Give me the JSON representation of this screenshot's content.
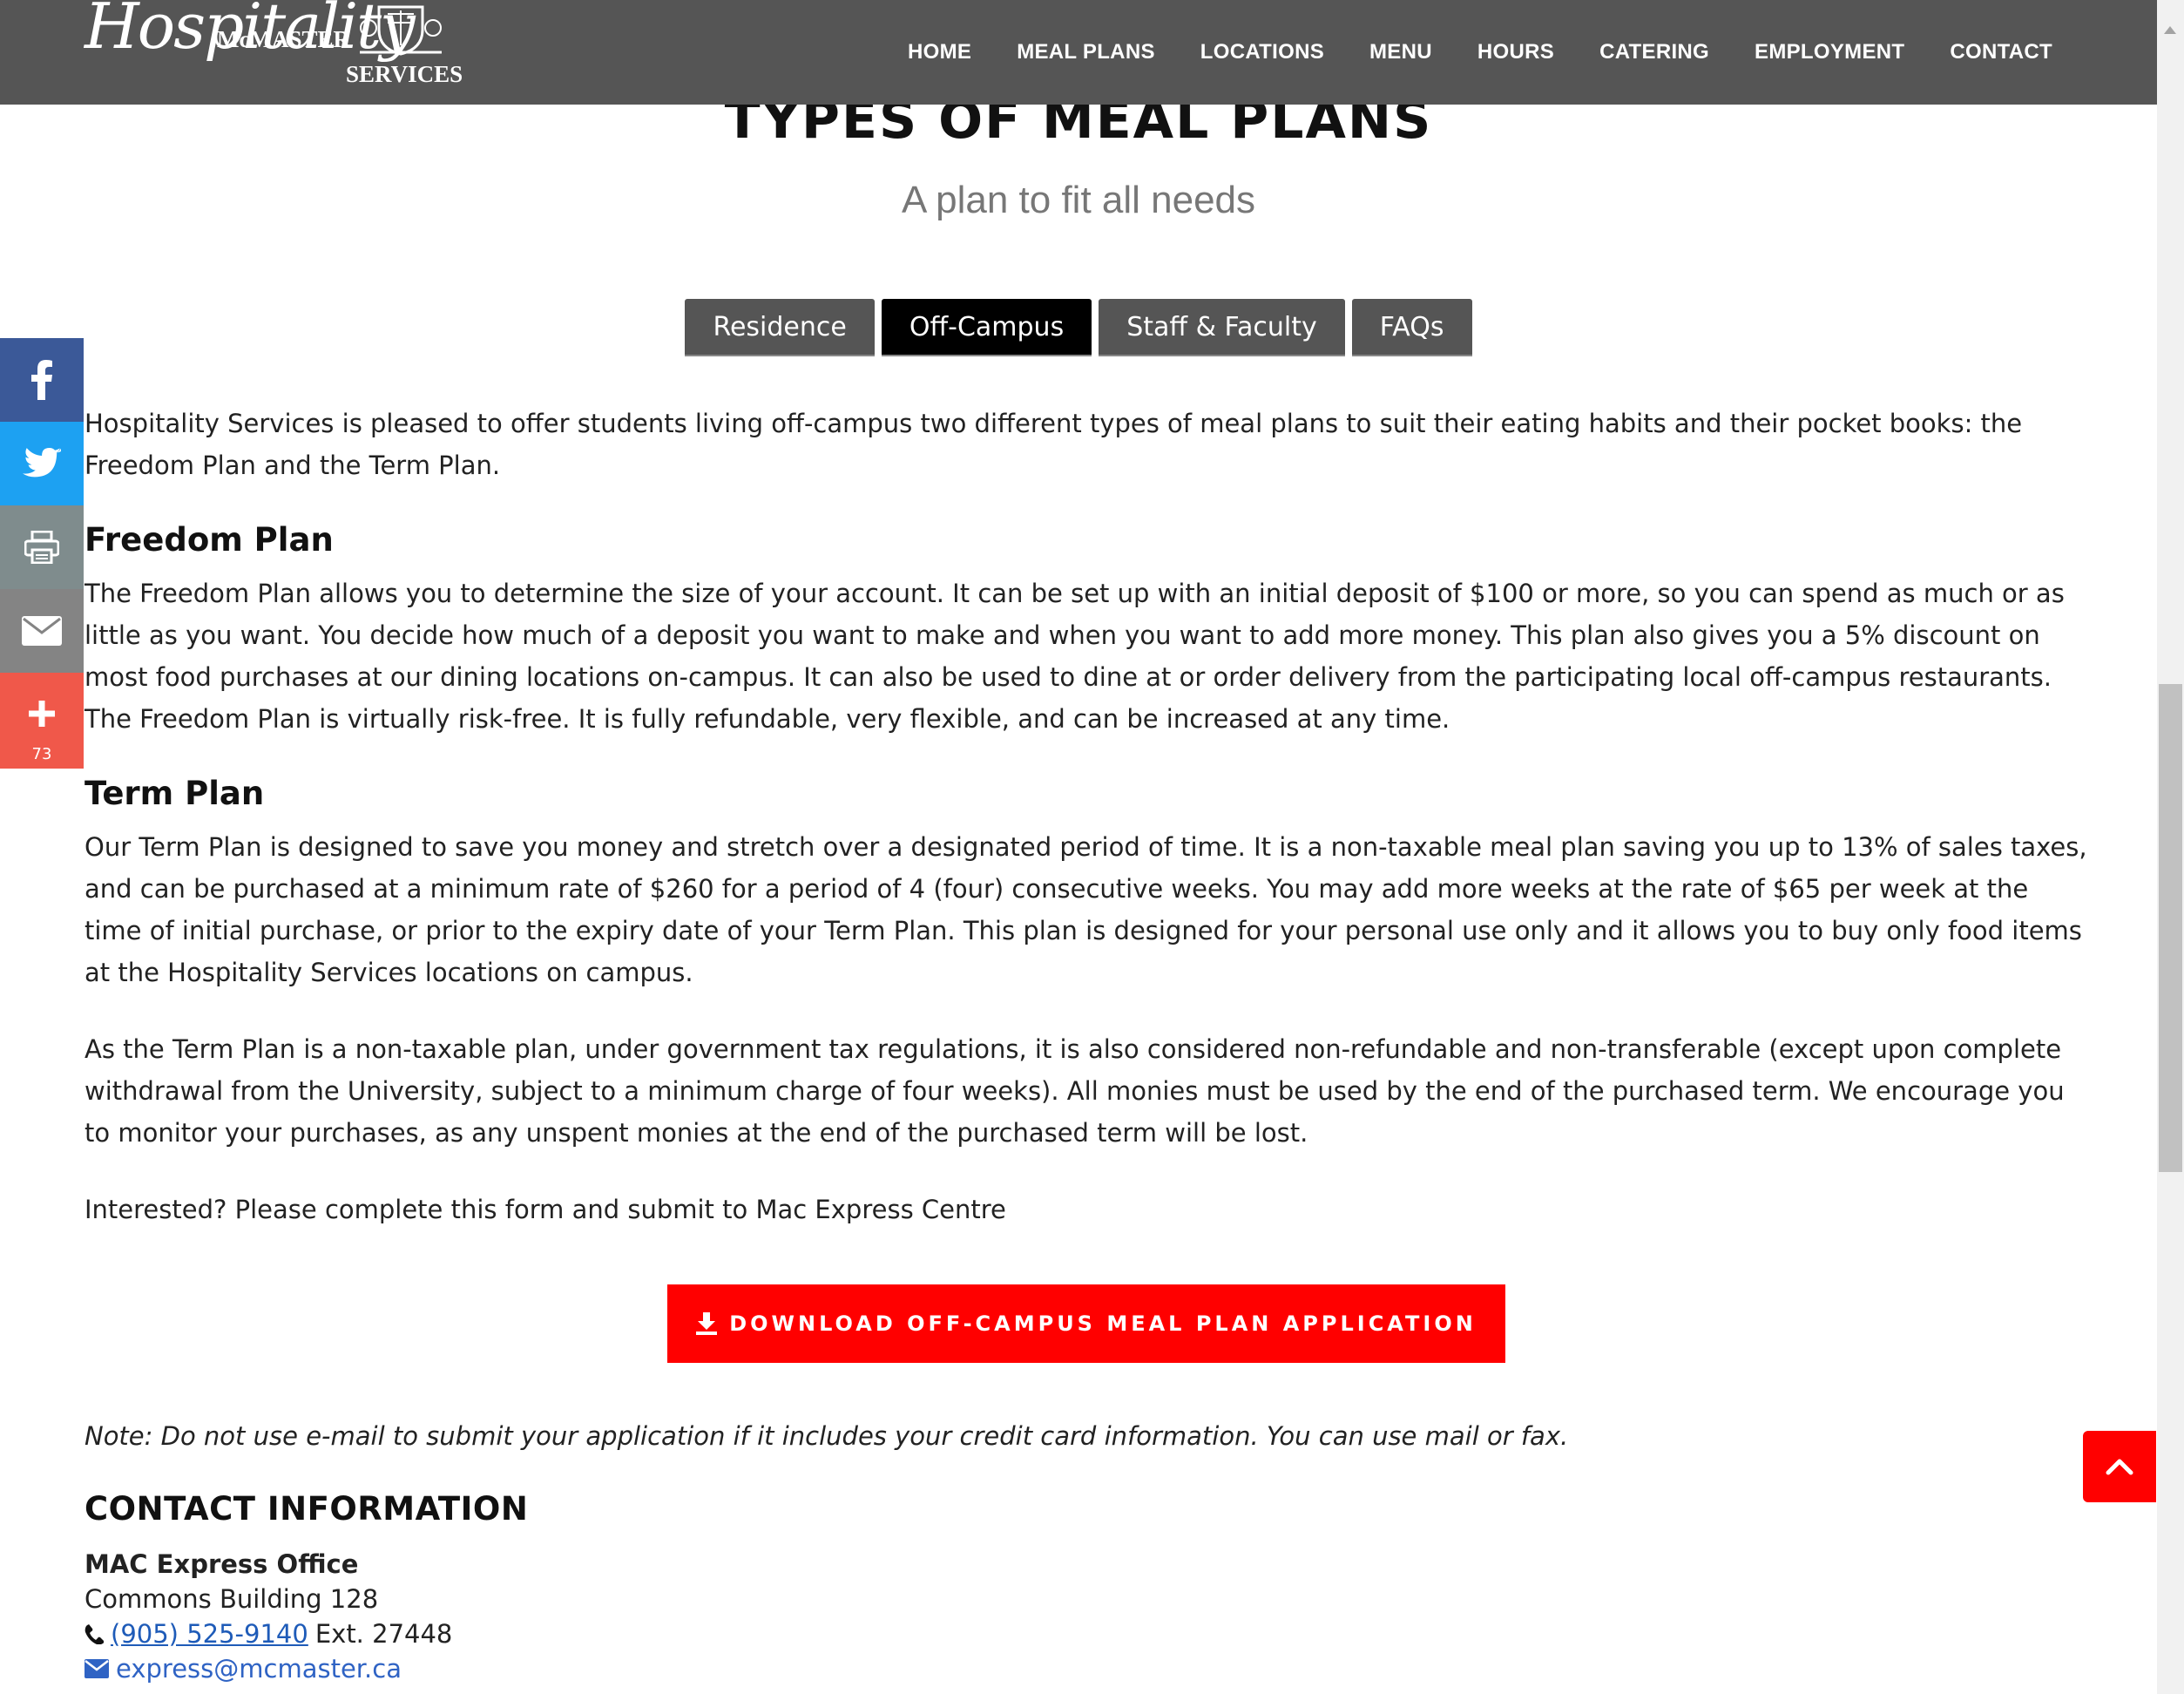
{
  "header": {
    "logo": {
      "top_text": "McMASTER",
      "script_text": "Hospitality",
      "bottom_text": "SERVICES"
    },
    "nav": [
      "HOME",
      "MEAL PLANS",
      "LOCATIONS",
      "MENU",
      "HOURS",
      "CATERING",
      "EMPLOYMENT",
      "CONTACT"
    ]
  },
  "page": {
    "title": "TYPES OF MEAL PLANS",
    "subtitle": "A plan to fit all needs"
  },
  "tabs": [
    {
      "label": "Residence",
      "active": false
    },
    {
      "label": "Off-Campus",
      "active": true
    },
    {
      "label": "Staff & Faculty",
      "active": false
    },
    {
      "label": "FAQs",
      "active": false
    }
  ],
  "share": {
    "buttons": [
      {
        "icon": "facebook-icon",
        "color": "#3b5998"
      },
      {
        "icon": "twitter-icon",
        "color": "#1da1f2"
      },
      {
        "icon": "print-icon",
        "color": "#7f8c8d"
      },
      {
        "icon": "email-icon",
        "color": "#848484"
      },
      {
        "icon": "plus-icon",
        "color": "#f0584a"
      }
    ],
    "count": "73"
  },
  "content": {
    "intro": "Hospitality Services is pleased to offer students living off-campus two different types of meal plans to suit their eating habits and their pocket books: the Freedom Plan and the Term Plan.",
    "freedom_heading": "Freedom Plan",
    "freedom_text": "The Freedom Plan allows you to determine the size of your account. It can be set up with an initial deposit of $100 or more, so you can spend as much or as little as you want. You decide how much of a deposit you want to make and when you want to add more money. This plan also gives you a 5% discount on most food purchases at our dining locations on-campus. It can also be used to dine at or order delivery from the participating local off-campus restaurants. The Freedom Plan is virtually risk-free. It is fully refundable, very flexible, and can be increased at any time.",
    "term_heading": "Term Plan",
    "term_text_1": "Our Term Plan is designed to save you money and stretch over a designated period of time. It is a non-taxable meal plan saving you up to 13% of sales taxes, and can be purchased at a minimum rate of $260 for a period of 4 (four) consecutive weeks. You may add more weeks at the rate of $65 per week at the time of initial purchase, or prior to the expiry date of your Term Plan. This plan is designed for your personal use only and it allows you to buy only food items at the Hospitality Services locations on campus.",
    "term_text_2": "As the Term Plan is a non-taxable plan, under government tax regulations, it is also considered non-refundable and non-transferable (except upon complete withdrawal from the University, subject to a minimum charge of four weeks). All monies must be used by the end of the purchased term. We encourage you to monitor your purchases, as any unspent monies at the end of the purchased term will be lost.",
    "interested": "Interested? Please complete this form and submit to Mac Express Centre",
    "download_label": "DOWNLOAD OFF-CAMPUS MEAL PLAN APPLICATION",
    "note": "Note: Do not use e-mail to submit your application if it includes your credit card information. You can use mail or fax."
  },
  "contact": {
    "heading": "CONTACT INFORMATION",
    "office": "MAC Express Office",
    "location": "Commons Building 128",
    "phone": "(905) 525-9140",
    "ext": "Ext. 27448",
    "email": "express@mcmaster.ca"
  },
  "colors": {
    "header_bg": "#555555",
    "accent_red": "#ff0000",
    "tab_bg": "#555555",
    "tab_active_bg": "#000000"
  }
}
